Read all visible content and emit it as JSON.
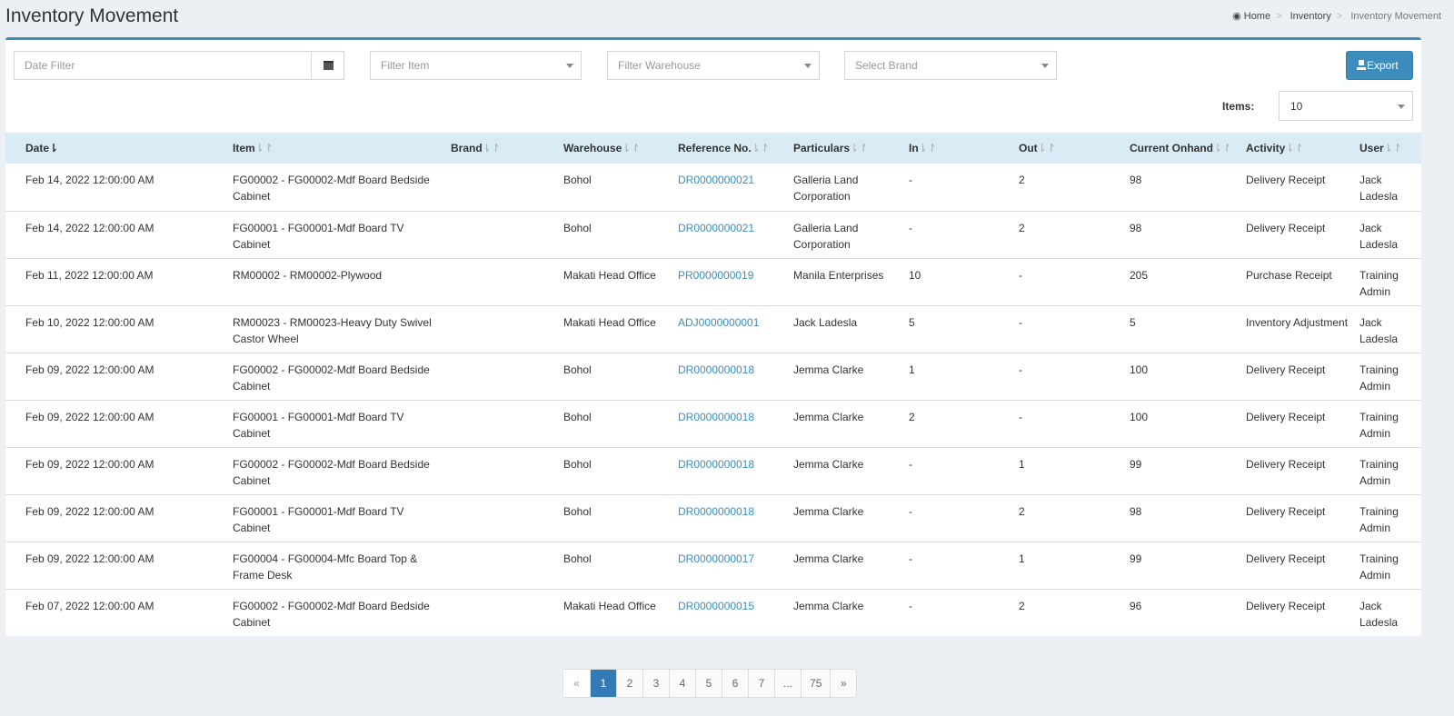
{
  "page": {
    "title": "Inventory Movement"
  },
  "breadcrumb": [
    "Home",
    "Inventory",
    "Inventory Movement"
  ],
  "filters": {
    "date": "Date Filter",
    "item": "Filter Item",
    "warehouse": "Filter Warehouse",
    "brand": "Select Brand",
    "export": "Export",
    "items_label": "Items:",
    "items_value": "10"
  },
  "columns": [
    "Date",
    "Item",
    "Brand",
    "Warehouse",
    "Reference No.",
    "Particulars",
    "In",
    "Out",
    "Current Onhand",
    "Activity",
    "User"
  ],
  "rows": [
    [
      "Feb 14, 2022 12:00:00 AM",
      "FG00002 - FG00002-Mdf Board Bedside Cabinet",
      "",
      "Bohol",
      "DR0000000021",
      "Galleria Land Corporation",
      "-",
      "2",
      "98",
      "Delivery Receipt",
      "Jack Ladesla"
    ],
    [
      "Feb 14, 2022 12:00:00 AM",
      "FG00001 - FG00001-Mdf Board TV Cabinet",
      "",
      "Bohol",
      "DR0000000021",
      "Galleria Land Corporation",
      "-",
      "2",
      "98",
      "Delivery Receipt",
      "Jack Ladesla"
    ],
    [
      "Feb 11, 2022 12:00:00 AM",
      "RM00002 - RM00002-Plywood",
      "",
      "Makati Head Office",
      "PR0000000019",
      "Manila Enterprises",
      "10",
      "-",
      "205",
      "Purchase Receipt",
      "Training Admin"
    ],
    [
      "Feb 10, 2022 12:00:00 AM",
      "RM00023 - RM00023-Heavy Duty Swivel Castor Wheel",
      "",
      "Makati Head Office",
      "ADJ0000000001",
      "Jack Ladesla",
      "5",
      "-",
      "5",
      "Inventory Adjustment",
      "Jack Ladesla"
    ],
    [
      "Feb 09, 2022 12:00:00 AM",
      "FG00002 - FG00002-Mdf Board Bedside Cabinet",
      "",
      "Bohol",
      "DR0000000018",
      "Jemma Clarke",
      "1",
      "-",
      "100",
      "Delivery Receipt",
      "Training Admin"
    ],
    [
      "Feb 09, 2022 12:00:00 AM",
      "FG00001 - FG00001-Mdf Board TV Cabinet",
      "",
      "Bohol",
      "DR0000000018",
      "Jemma Clarke",
      "2",
      "-",
      "100",
      "Delivery Receipt",
      "Training Admin"
    ],
    [
      "Feb 09, 2022 12:00:00 AM",
      "FG00002 - FG00002-Mdf Board Bedside Cabinet",
      "",
      "Bohol",
      "DR0000000018",
      "Jemma Clarke",
      "-",
      "1",
      "99",
      "Delivery Receipt",
      "Training Admin"
    ],
    [
      "Feb 09, 2022 12:00:00 AM",
      "FG00001 - FG00001-Mdf Board TV Cabinet",
      "",
      "Bohol",
      "DR0000000018",
      "Jemma Clarke",
      "-",
      "2",
      "98",
      "Delivery Receipt",
      "Training Admin"
    ],
    [
      "Feb 09, 2022 12:00:00 AM",
      "FG00004 - FG00004-Mfc Board Top & Frame Desk",
      "",
      "Bohol",
      "DR0000000017",
      "Jemma Clarke",
      "-",
      "1",
      "99",
      "Delivery Receipt",
      "Training Admin"
    ],
    [
      "Feb 07, 2022 12:00:00 AM",
      "FG00002 - FG00002-Mdf Board Bedside Cabinet",
      "",
      "Makati Head Office",
      "DR0000000015",
      "Jemma Clarke",
      "-",
      "2",
      "96",
      "Delivery Receipt",
      "Jack Ladesla"
    ]
  ],
  "pagination": {
    "prev": "«",
    "pages": [
      "1",
      "2",
      "3",
      "4",
      "5",
      "6",
      "7",
      "...",
      "75"
    ],
    "next": "»",
    "current": "1"
  }
}
